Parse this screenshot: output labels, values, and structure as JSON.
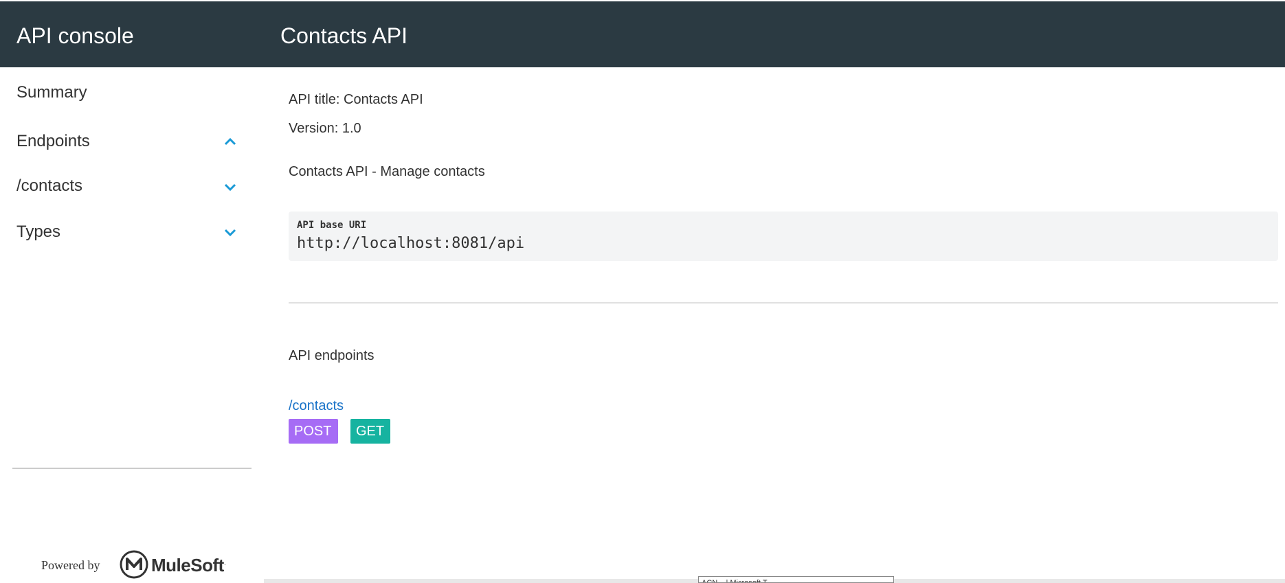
{
  "header": {
    "app_title": "API console",
    "api_title": "Contacts API"
  },
  "sidebar": {
    "items": [
      {
        "label": "Summary",
        "chevron": null
      },
      {
        "label": "Endpoints",
        "chevron": "chevron-up-icon"
      },
      {
        "label": "/contacts",
        "chevron": "chevron-down-icon"
      },
      {
        "label": "Types",
        "chevron": "chevron-down-icon"
      }
    ],
    "powered_by": "Powered by",
    "brand": "MuleSoft"
  },
  "main": {
    "api_title_line": "API title: Contacts API",
    "version_line": "Version: 1.0",
    "description": "Contacts API - Manage contacts",
    "base_uri_label": "API base URI",
    "base_uri_value": "http://localhost:8081/api",
    "endpoints_heading": "API endpoints",
    "endpoints": [
      {
        "path": "/contacts",
        "methods": [
          "POST",
          "GET"
        ]
      }
    ]
  },
  "tooltip": {
    "text": "ACN... | Microsoft T..."
  },
  "colors": {
    "header_bg": "#2b3a42",
    "accent_chevron": "#1a9ad6",
    "link": "#1a73c8",
    "post": "#a66cf5",
    "get": "#16b3a0"
  }
}
